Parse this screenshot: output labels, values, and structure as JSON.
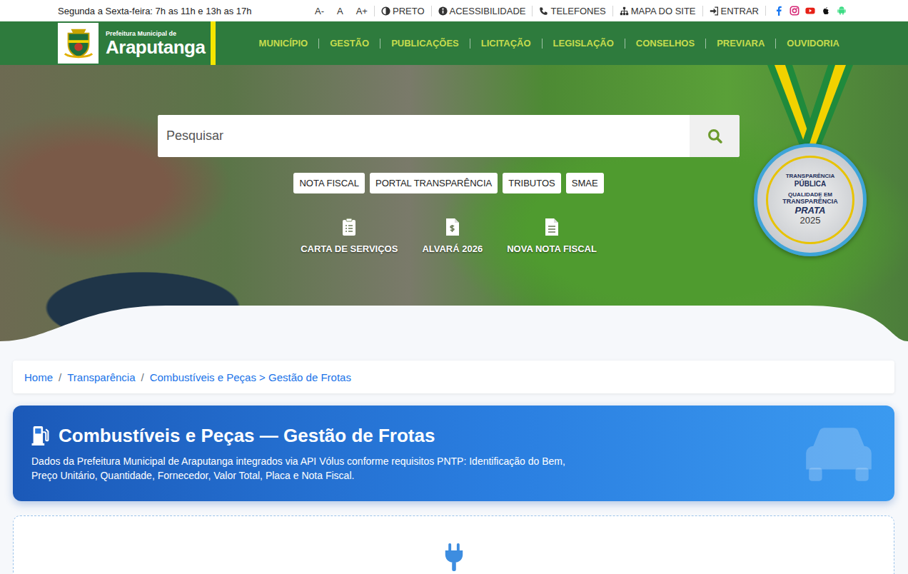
{
  "topbar": {
    "hours": "Segunda a Sexta-feira: 7h as 11h e 13h as 17h",
    "links": [
      {
        "label": "A-",
        "kind": "text"
      },
      {
        "label": "A",
        "kind": "text"
      },
      {
        "label": "A+",
        "kind": "text"
      },
      {
        "label": "PRETO",
        "kind": "contrast"
      },
      {
        "label": "ACESSIBILIDADE",
        "kind": "info"
      },
      {
        "label": "TELEFONES",
        "kind": "phone"
      },
      {
        "label": "MAPA DO SITE",
        "kind": "sitemap"
      },
      {
        "label": "ENTRAR",
        "kind": "login"
      }
    ],
    "social": [
      {
        "kind": "facebook",
        "color": "#1877f2"
      },
      {
        "kind": "instagram",
        "color": "#d62976"
      },
      {
        "kind": "youtube",
        "color": "#e62117"
      },
      {
        "kind": "apple",
        "color": "#111111"
      },
      {
        "kind": "android",
        "color": "#3ddc84"
      }
    ]
  },
  "header": {
    "logo_small": "Prefeitura Municipal de",
    "logo_big": "Araputanga",
    "nav": [
      "MUNICÍPIO",
      "GESTÃO",
      "PUBLICAÇÕES",
      "LICITAÇÃO",
      "LEGISLAÇÃO",
      "CONSELHOS",
      "PREVIARA",
      "OUVIDORIA"
    ]
  },
  "hero": {
    "search_placeholder": "Pesquisar",
    "quick_buttons": [
      "NOTA FISCAL",
      "PORTAL TRANSPARÊNCIA",
      "TRIBUTOS",
      "SMAE"
    ],
    "services": [
      {
        "label": "CARTA DE SERVIÇOS",
        "kind": "clipboard"
      },
      {
        "label": "ALVARÁ 2026",
        "kind": "invoice"
      },
      {
        "label": "NOVA NOTA FISCAL",
        "kind": "document"
      }
    ],
    "medal": {
      "brand_top": "TRANSPARÊNCIA",
      "brand_bottom": "PÚBLICA",
      "line1": "QUALIDADE EM",
      "line2": "TRANSPARÊNCIA",
      "grade": "PRATA",
      "year": "2025"
    }
  },
  "breadcrumb": {
    "separator": "/",
    "items": [
      "Home",
      "Transparência",
      "Combustíveis e Peças > Gestão de Frotas"
    ]
  },
  "banner": {
    "title": "Combustíveis e Peças — Gestão de Frotas",
    "description": "Dados da Prefeitura Municipal de Araputanga integrados via API Vólus conforme requisitos PNTP: Identificação do Bem, Preço Unitário, Quantidade, Fornecedor, Valor Total, Placa e Nota Fiscal."
  }
}
